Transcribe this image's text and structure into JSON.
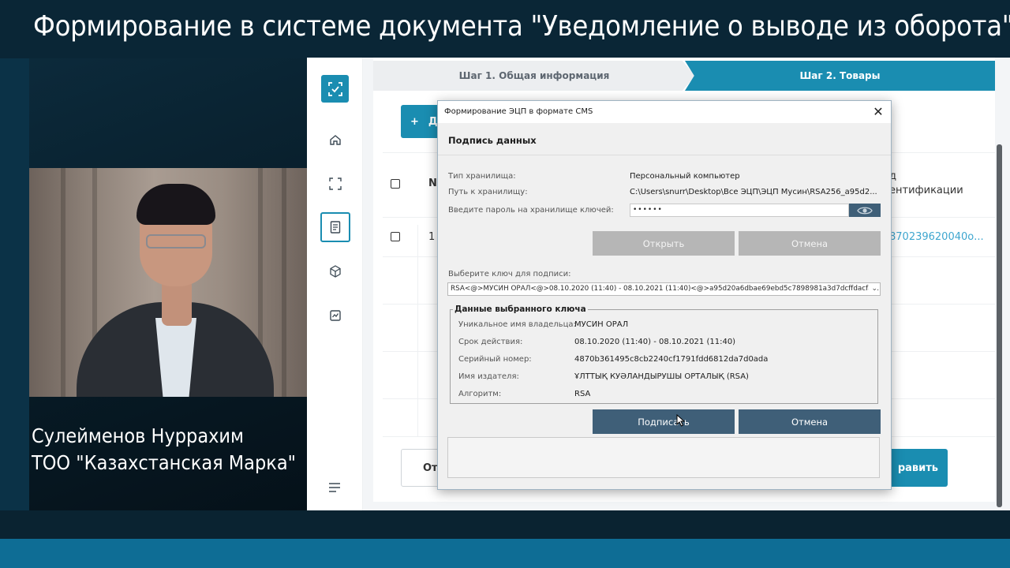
{
  "banner": {
    "title": "Формирование в системе документа \"Уведомление о выводе из оборота\""
  },
  "speaker": {
    "name": "Сулейменов Нуррахим",
    "company": "ТОО \"Казахстанская Марка\""
  },
  "app": {
    "steps": [
      {
        "label": "Шаг 1. Общая информация",
        "active": false
      },
      {
        "label": "Шаг 2. Товары",
        "active": true
      }
    ],
    "add_button": {
      "icon": "plus",
      "label": "Д"
    },
    "table": {
      "col_number": "N",
      "col_right_line1": "д",
      "col_right_line2": "ентификации",
      "rows": [
        {
          "number": "1",
          "code": "870239620040о..."
        }
      ]
    },
    "footer": {
      "back_label": "От",
      "send_label": "равить"
    },
    "sidebar_icons": [
      "scan-logo-icon",
      "home-icon",
      "scan-frame-icon",
      "document-icon",
      "box-icon",
      "chart-icon",
      "menu-icon"
    ],
    "accent_color": "#1a8db1"
  },
  "dialog": {
    "title": "Формирование ЭЦП в формате CMS",
    "heading": "Подпись данных",
    "storage_type_label": "Тип хранилища:",
    "storage_type_value": "Персональный компьютер",
    "storage_path_label": "Путь к хранилищу:",
    "storage_path_value": "C:\\Users\\snurr\\Desktop\\Все ЭЦП\\ЭЦП Мусин\\RSA256_a95d2...",
    "password_label": "Введите пароль на хранилище ключей:",
    "password_value": "••••••",
    "open_button": "Открыть",
    "cancel_button_top": "Отмена",
    "select_key_label": "Выберите ключ для подписи:",
    "selected_key": "RSA<@>МУСИН ОРАЛ<@>08.10.2020 (11:40) - 08.10.2021 (11:40)<@>a95d20a6dbae69ebd5c7898981a3d7dcffdacfa...",
    "key_data_legend": "Данные выбранного ключа",
    "key_data": [
      {
        "label": "Уникальное имя владельца:",
        "value": "МУСИН ОРАЛ"
      },
      {
        "label": "Срок действия:",
        "value": "08.10.2020 (11:40) - 08.10.2021 (11:40)"
      },
      {
        "label": "Серийный номер:",
        "value": "4870b361495c8cb2240cf1791fdd6812da7d0ada"
      },
      {
        "label": "Имя издателя:",
        "value": "ҰЛТТЫҚ КУӘЛАНДЫРУШЫ ОРТАЛЫҚ (RSA)"
      },
      {
        "label": "Алгоритм:",
        "value": "RSA"
      }
    ],
    "sign_button": "Подписать",
    "cancel_button_bottom": "Отмена",
    "button_color": "#3f5f78"
  }
}
